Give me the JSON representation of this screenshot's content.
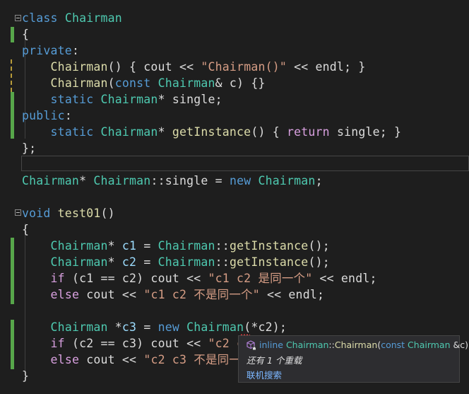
{
  "code_lines": [
    [
      {
        "t": "class ",
        "c": "kw"
      },
      {
        "t": "Chairman",
        "c": "ty"
      }
    ],
    [
      {
        "t": "{",
        "c": "pl"
      }
    ],
    [
      {
        "t": "private",
        "c": "kw"
      },
      {
        "t": ":",
        "c": "pl"
      }
    ],
    [
      {
        "t": "    ",
        "c": "pl"
      },
      {
        "t": "Chairman",
        "c": "fn"
      },
      {
        "t": "() { cout ",
        "c": "pl"
      },
      {
        "t": "<<",
        "c": "pl"
      },
      {
        "t": " ",
        "c": "pl"
      },
      {
        "t": "\"Chairman()\"",
        "c": "str"
      },
      {
        "t": " << endl; }",
        "c": "pl"
      }
    ],
    [
      {
        "t": "    ",
        "c": "pl"
      },
      {
        "t": "Chairman",
        "c": "fn"
      },
      {
        "t": "(",
        "c": "pl"
      },
      {
        "t": "const ",
        "c": "kw"
      },
      {
        "t": "Chairman",
        "c": "ty"
      },
      {
        "t": "& c) {}",
        "c": "pl"
      }
    ],
    [
      {
        "t": "    ",
        "c": "pl"
      },
      {
        "t": "static ",
        "c": "kw"
      },
      {
        "t": "Chairman",
        "c": "ty"
      },
      {
        "t": "* single;",
        "c": "pl"
      }
    ],
    [
      {
        "t": "public",
        "c": "kw"
      },
      {
        "t": ":",
        "c": "pl"
      }
    ],
    [
      {
        "t": "    ",
        "c": "pl"
      },
      {
        "t": "static ",
        "c": "kw"
      },
      {
        "t": "Chairman",
        "c": "ty"
      },
      {
        "t": "* ",
        "c": "pl"
      },
      {
        "t": "getInstance",
        "c": "fn"
      },
      {
        "t": "() { ",
        "c": "pl"
      },
      {
        "t": "return",
        "c": "kw2"
      },
      {
        "t": " single; }",
        "c": "pl"
      }
    ],
    [
      {
        "t": "};",
        "c": "pl"
      }
    ],
    [],
    [
      {
        "t": "Chairman",
        "c": "ty"
      },
      {
        "t": "* ",
        "c": "pl"
      },
      {
        "t": "Chairman",
        "c": "ty"
      },
      {
        "t": "::",
        "c": "pl"
      },
      {
        "t": "single = ",
        "c": "pl"
      },
      {
        "t": "new ",
        "c": "kw"
      },
      {
        "t": "Chairman",
        "c": "ty"
      },
      {
        "t": ";",
        "c": "pl"
      }
    ],
    [],
    [
      {
        "t": "void ",
        "c": "kw"
      },
      {
        "t": "test01",
        "c": "fn"
      },
      {
        "t": "()",
        "c": "pl"
      }
    ],
    [
      {
        "t": "{",
        "c": "pl"
      }
    ],
    [
      {
        "t": "    ",
        "c": "pl"
      },
      {
        "t": "Chairman",
        "c": "ty"
      },
      {
        "t": "* ",
        "c": "pl"
      },
      {
        "t": "c1",
        "c": "var"
      },
      {
        "t": " = ",
        "c": "pl"
      },
      {
        "t": "Chairman",
        "c": "ty"
      },
      {
        "t": "::",
        "c": "pl"
      },
      {
        "t": "getInstance",
        "c": "fn"
      },
      {
        "t": "();",
        "c": "pl"
      }
    ],
    [
      {
        "t": "    ",
        "c": "pl"
      },
      {
        "t": "Chairman",
        "c": "ty"
      },
      {
        "t": "* ",
        "c": "pl"
      },
      {
        "t": "c2",
        "c": "var"
      },
      {
        "t": " = ",
        "c": "pl"
      },
      {
        "t": "Chairman",
        "c": "ty"
      },
      {
        "t": "::",
        "c": "pl"
      },
      {
        "t": "getInstance",
        "c": "fn"
      },
      {
        "t": "();",
        "c": "pl"
      }
    ],
    [
      {
        "t": "    ",
        "c": "pl"
      },
      {
        "t": "if",
        "c": "kw2"
      },
      {
        "t": " (c1 == c2) cout << ",
        "c": "pl"
      },
      {
        "t": "\"c1 c2 是同一个\"",
        "c": "str"
      },
      {
        "t": " << endl;",
        "c": "pl"
      }
    ],
    [
      {
        "t": "    ",
        "c": "pl"
      },
      {
        "t": "else",
        "c": "kw2"
      },
      {
        "t": " cout << ",
        "c": "pl"
      },
      {
        "t": "\"c1 c2 不是同一个\"",
        "c": "str"
      },
      {
        "t": " << endl;",
        "c": "pl"
      }
    ],
    [],
    [
      {
        "t": "    ",
        "c": "pl"
      },
      {
        "t": "Chairman",
        "c": "ty"
      },
      {
        "t": " *",
        "c": "pl"
      },
      {
        "t": "c3",
        "c": "var"
      },
      {
        "t": " = ",
        "c": "pl"
      },
      {
        "t": "new ",
        "c": "kw"
      },
      {
        "t": "Chairman",
        "c": "ty"
      },
      {
        "t": "(*c2);",
        "c": "pl"
      }
    ],
    [
      {
        "t": "    ",
        "c": "pl"
      },
      {
        "t": "if",
        "c": "kw2"
      },
      {
        "t": " (c2 == c3) cout << ",
        "c": "pl"
      },
      {
        "t": "\"c2 c",
        "c": "str"
      }
    ],
    [
      {
        "t": "    ",
        "c": "pl"
      },
      {
        "t": "else",
        "c": "kw2"
      },
      {
        "t": " cout << ",
        "c": "pl"
      },
      {
        "t": "\"c2 c3 不是同一",
        "c": "str"
      }
    ],
    [
      {
        "t": "}",
        "c": "pl"
      }
    ]
  ],
  "tooltip": {
    "signature_prefix": "inline ",
    "signature_class": "Chairman",
    "signature_sep": "::",
    "signature_func": "Chairman",
    "signature_open": "(",
    "signature_const": "const ",
    "signature_type": "Chairman",
    "signature_rest": " &c)",
    "overloads": "还有 1 个重载",
    "search_link": "联机搜索"
  },
  "colors": {
    "background": "#1e1e1e",
    "keyword": "#569cd6",
    "control_keyword": "#d8a0df",
    "type": "#4ec9b0",
    "function": "#dcdcaa",
    "string": "#d69d85",
    "variable": "#9cdcfe",
    "change_bar_green": "#57a64a",
    "change_bar_yellow": "#b89b3a"
  }
}
